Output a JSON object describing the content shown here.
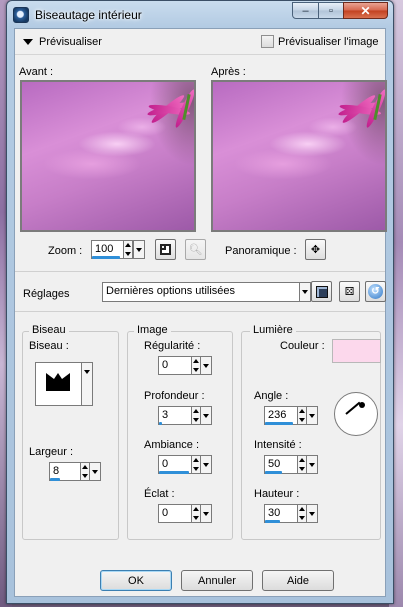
{
  "window": {
    "title": "Biseautage intérieur"
  },
  "preview": {
    "header_label": "Prévisualiser",
    "preview_image_label": "Prévisualiser l'image",
    "before_label": "Avant :",
    "after_label": "Après :",
    "zoom_label": "Zoom :",
    "zoom_value": "100",
    "pan_label": "Panoramique :"
  },
  "settings": {
    "label": "Réglages",
    "preset_value": "Dernières options utilisées"
  },
  "bevel": {
    "group_title": "Biseau",
    "bevel_label": "Biseau :",
    "width_label": "Largeur :",
    "width_value": "8"
  },
  "image": {
    "group_title": "Image",
    "smoothness_label": "Régularité :",
    "smoothness_value": "0",
    "depth_label": "Profondeur :",
    "depth_value": "3",
    "ambience_label": "Ambiance :",
    "ambience_value": "0",
    "shininess_label": "Éclat :",
    "shininess_value": "0"
  },
  "light": {
    "group_title": "Lumière",
    "color_label": "Couleur :",
    "color": "#fcd8ec",
    "angle_label": "Angle :",
    "angle_value": "236",
    "intensity_label": "Intensité :",
    "intensity_value": "50",
    "elevation_label": "Hauteur :",
    "elevation_value": "30"
  },
  "buttons": {
    "ok": "OK",
    "cancel": "Annuler",
    "help": "Aide"
  },
  "icons": {
    "pan": "move-arrows-icon",
    "save": "save-disk-icon",
    "random": "dice-icon",
    "reset": "reset-icon"
  }
}
